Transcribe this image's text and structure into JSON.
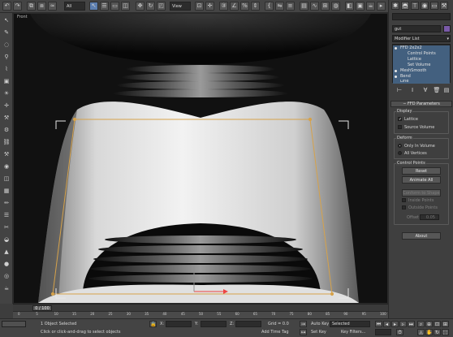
{
  "toolbar": {
    "selection_filter": "All",
    "ref_coord": "View",
    "ref_coord_2": "View"
  },
  "viewport": {
    "label": "Front"
  },
  "timeline": {
    "frame_display": "0 / 100",
    "ticks": [
      "0",
      "5",
      "10",
      "15",
      "20",
      "25",
      "30",
      "35",
      "40",
      "45",
      "50",
      "55",
      "60",
      "65",
      "70",
      "75",
      "80",
      "85",
      "90",
      "95",
      "100"
    ]
  },
  "status": {
    "selection_text": "1 Object Selected",
    "prompt_text": "Click or click-and-drag to select objects",
    "x_label": "X:",
    "y_label": "Y:",
    "z_label": "Z:",
    "grid_text": "Grid = 0.0",
    "add_time_tag": "Add Time Tag",
    "auto_key": "Auto Key",
    "set_key": "Set Key",
    "key_mode_value": "Selected",
    "key_filters": "Key Filters..."
  },
  "command_panel": {
    "search_field": "",
    "object_name": "gut",
    "modifier_list_label": "Modifier List",
    "stack": [
      {
        "label": "FFD 2x2x2",
        "level": 0,
        "selected": true
      },
      {
        "label": "Control Points",
        "level": 1,
        "selected": true
      },
      {
        "label": "Lattice",
        "level": 1,
        "selected": true
      },
      {
        "label": "Set Volume",
        "level": 1,
        "selected": true
      },
      {
        "label": "MeshSmooth",
        "level": 0,
        "selected": true
      },
      {
        "label": "Bend",
        "level": 0,
        "selected": true
      },
      {
        "label": "Line",
        "level": 0,
        "selected": true
      }
    ],
    "rollout_title": "FFD Parameters",
    "display_group": "Display",
    "display_lattice": "Lattice",
    "display_source_volume": "Source Volume",
    "deform_group": "Deform",
    "deform_only_in_volume": "Only In Volume",
    "deform_all_vertices": "All Vertices",
    "control_points_group": "Control Points",
    "reset_button": "Reset",
    "animate_all_button": "Animate All",
    "conform_to_shape_button": "Conform to Shape",
    "inside_points": "Inside Points",
    "outside_points": "Outside Points",
    "offset_label": "Offset",
    "offset_value": "0.05",
    "about_button": "About"
  },
  "colors": {
    "lattice": "#d6a24a",
    "selection_blue": "#43607f",
    "background": "#3d3d3d"
  }
}
